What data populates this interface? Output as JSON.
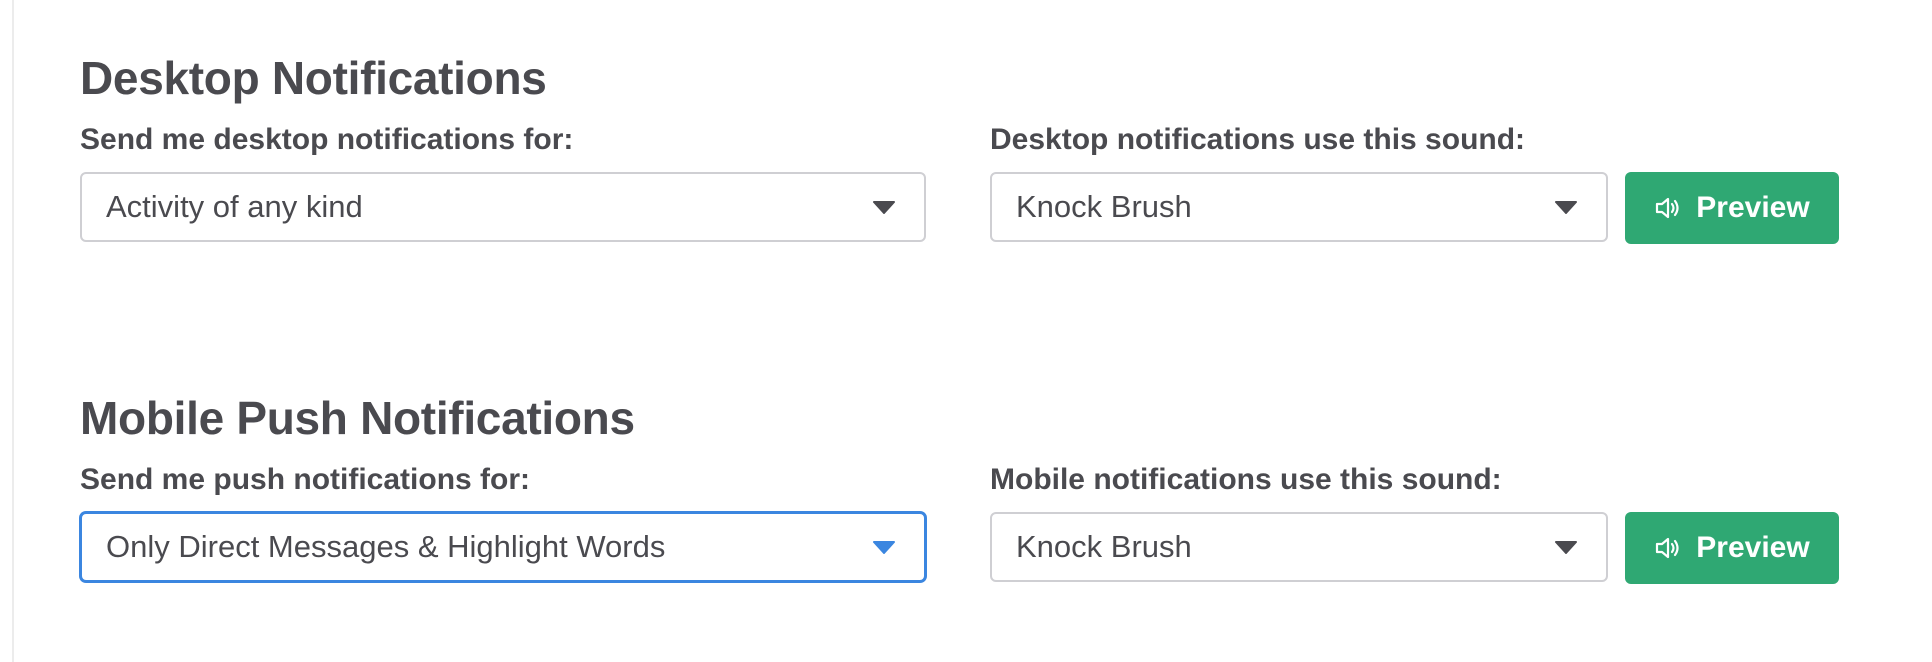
{
  "desktop": {
    "title": "Desktop Notifications",
    "send_label": "Send me desktop notifications for:",
    "send_value": "Activity of any kind",
    "sound_label": "Desktop notifications use this sound:",
    "sound_value": "Knock Brush",
    "preview_label": "Preview"
  },
  "mobile": {
    "title": "Mobile Push Notifications",
    "send_label": "Send me push notifications for:",
    "send_value": "Only Direct Messages & Highlight Words",
    "sound_label": "Mobile notifications use this sound:",
    "sound_value": "Knock Brush",
    "preview_label": "Preview"
  },
  "colors": {
    "accent_green": "#2fa873",
    "focus_blue": "#3b86e0",
    "text": "#4a4a4f",
    "border": "#cfcfd3"
  },
  "icons": {
    "dropdown": "chevron-down-icon",
    "preview": "speaker-icon"
  }
}
